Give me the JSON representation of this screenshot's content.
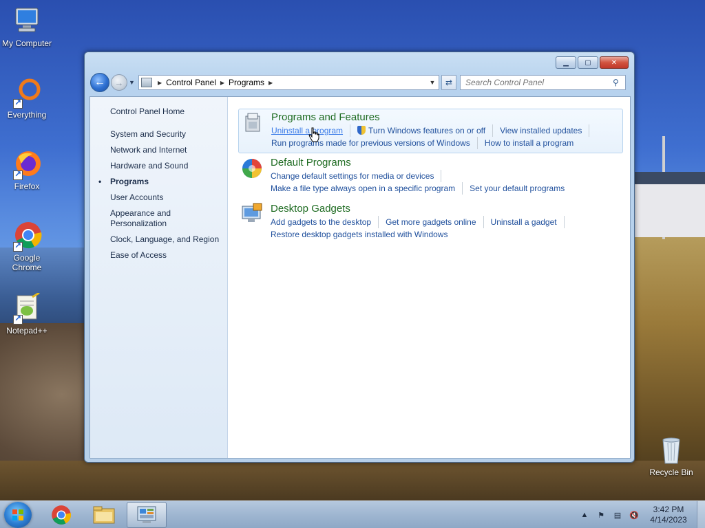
{
  "desktop": {
    "icons": [
      {
        "label": "My Computer"
      },
      {
        "label": "Everything"
      },
      {
        "label": "Firefox"
      },
      {
        "label": "Google Chrome"
      },
      {
        "label": "Notepad++"
      },
      {
        "label": "Recycle Bin"
      }
    ]
  },
  "window": {
    "controls": {
      "minimize": "▁",
      "maximize": "▢",
      "close": "✕"
    },
    "breadcrumb": [
      "Control Panel",
      "Programs"
    ],
    "search_placeholder": "Search Control Panel",
    "sidebar": {
      "home": "Control Panel Home",
      "items": [
        "System and Security",
        "Network and Internet",
        "Hardware and Sound",
        "Programs",
        "User Accounts",
        "Appearance and Personalization",
        "Clock, Language, and Region",
        "Ease of Access"
      ],
      "current_index": 3
    },
    "categories": [
      {
        "title": "Programs and Features",
        "icon": "programs-features-icon",
        "links": [
          "Uninstall a program",
          "Turn Windows features on or off",
          "View installed updates",
          "Run programs made for previous versions of Windows",
          "How to install a program"
        ]
      },
      {
        "title": "Default Programs",
        "icon": "default-programs-icon",
        "links": [
          "Change default settings for media or devices",
          "Make a file type always open in a specific program",
          "Set your default programs"
        ]
      },
      {
        "title": "Desktop Gadgets",
        "icon": "desktop-gadgets-icon",
        "links": [
          "Add gadgets to the desktop",
          "Get more gadgets online",
          "Uninstall a gadget",
          "Restore desktop gadgets installed with Windows"
        ]
      }
    ]
  },
  "taskbar": {
    "time": "3:42 PM",
    "date": "4/14/2023"
  },
  "colors": {
    "category_title": "#1e6b21",
    "link": "#1f4f9c",
    "link_hover": "#3b7be8"
  }
}
